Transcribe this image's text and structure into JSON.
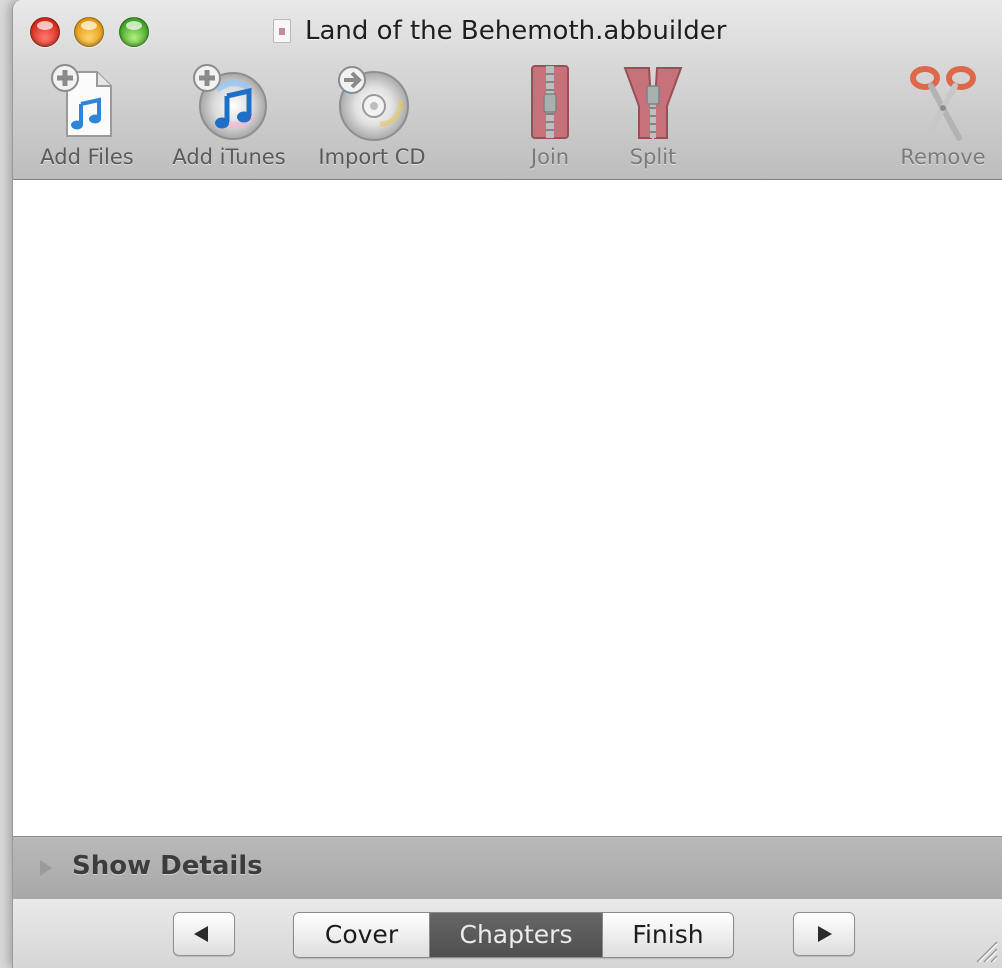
{
  "window": {
    "title": "Land of the Behemoth.abbuilder"
  },
  "toolbar": {
    "items": [
      {
        "label": "Add Files",
        "icon": "add-files-icon",
        "enabled": true
      },
      {
        "label": "Add iTunes",
        "icon": "add-itunes-icon",
        "enabled": true
      },
      {
        "label": "Import CD",
        "icon": "import-cd-icon",
        "enabled": true
      },
      {
        "label": "Join",
        "icon": "join-icon",
        "enabled": false
      },
      {
        "label": "Split",
        "icon": "split-icon",
        "enabled": false
      },
      {
        "label": "Remove",
        "icon": "scissors-icon",
        "enabled": false
      }
    ]
  },
  "details": {
    "label": "Show Details",
    "expanded": false
  },
  "footer": {
    "prev_icon": "left-triangle-icon",
    "next_icon": "right-triangle-icon",
    "steps": [
      "Cover",
      "Chapters",
      "Finish"
    ],
    "selected_step": "Chapters"
  },
  "colors": {
    "selected_segment": "#595959",
    "toolbar_gradient_top": "#e9e9e9",
    "toolbar_gradient_bottom": "#bdbdbd",
    "zipper_pink": "#c7717b",
    "scissors_orange": "#e0684a"
  }
}
